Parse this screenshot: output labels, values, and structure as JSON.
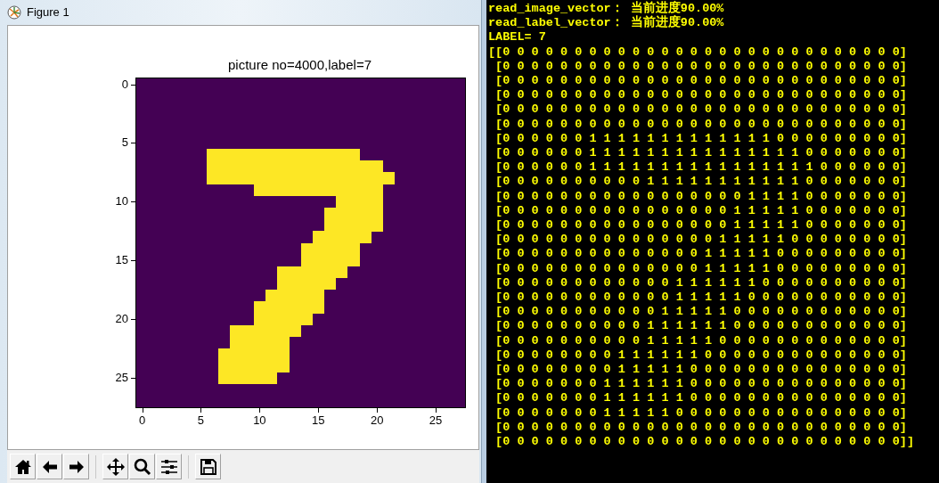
{
  "figure_window": {
    "title": "Figure 1",
    "plot": {
      "title": "picture no=4000,label=7",
      "xticks": [
        "0",
        "5",
        "10",
        "15",
        "20",
        "25"
      ],
      "yticks": [
        "0",
        "5",
        "10",
        "15",
        "20",
        "25"
      ]
    },
    "toolbar": [
      {
        "kind": "home"
      },
      {
        "kind": "back"
      },
      {
        "kind": "forward"
      },
      {
        "kind": "separator"
      },
      {
        "kind": "pan"
      },
      {
        "kind": "zoom"
      },
      {
        "kind": "subplots"
      },
      {
        "kind": "separator"
      },
      {
        "kind": "save"
      }
    ]
  },
  "console": {
    "log": [
      "read_image_vector： 当前进度90.00%",
      "read_label_vector： 当前进度90.00%",
      "LABEL= 7"
    ],
    "matrix": [
      "[[0 0 0 0 0 0 0 0 0 0 0 0 0 0 0 0 0 0 0 0 0 0 0 0 0 0 0 0]",
      " [0 0 0 0 0 0 0 0 0 0 0 0 0 0 0 0 0 0 0 0 0 0 0 0 0 0 0 0]",
      " [0 0 0 0 0 0 0 0 0 0 0 0 0 0 0 0 0 0 0 0 0 0 0 0 0 0 0 0]",
      " [0 0 0 0 0 0 0 0 0 0 0 0 0 0 0 0 0 0 0 0 0 0 0 0 0 0 0 0]",
      " [0 0 0 0 0 0 0 0 0 0 0 0 0 0 0 0 0 0 0 0 0 0 0 0 0 0 0 0]",
      " [0 0 0 0 0 0 0 0 0 0 0 0 0 0 0 0 0 0 0 0 0 0 0 0 0 0 0 0]",
      " [0 0 0 0 0 0 1 1 1 1 1 1 1 1 1 1 1 1 1 0 0 0 0 0 0 0 0 0]",
      " [0 0 0 0 0 0 1 1 1 1 1 1 1 1 1 1 1 1 1 1 1 0 0 0 0 0 0 0]",
      " [0 0 0 0 0 0 1 1 1 1 1 1 1 1 1 1 1 1 1 1 1 1 0 0 0 0 0 0]",
      " [0 0 0 0 0 0 0 0 0 0 1 1 1 1 1 1 1 1 1 1 1 0 0 0 0 0 0 0]",
      " [0 0 0 0 0 0 0 0 0 0 0 0 0 0 0 0 0 1 1 1 1 0 0 0 0 0 0 0]",
      " [0 0 0 0 0 0 0 0 0 0 0 0 0 0 0 0 1 1 1 1 1 0 0 0 0 0 0 0]",
      " [0 0 0 0 0 0 0 0 0 0 0 0 0 0 0 0 1 1 1 1 1 0 0 0 0 0 0 0]",
      " [0 0 0 0 0 0 0 0 0 0 0 0 0 0 0 1 1 1 1 1 0 0 0 0 0 0 0 0]",
      " [0 0 0 0 0 0 0 0 0 0 0 0 0 0 1 1 1 1 1 0 0 0 0 0 0 0 0 0]",
      " [0 0 0 0 0 0 0 0 0 0 0 0 0 0 1 1 1 1 1 0 0 0 0 0 0 0 0 0]",
      " [0 0 0 0 0 0 0 0 0 0 0 0 1 1 1 1 1 1 0 0 0 0 0 0 0 0 0 0]",
      " [0 0 0 0 0 0 0 0 0 0 0 0 1 1 1 1 1 0 0 0 0 0 0 0 0 0 0 0]",
      " [0 0 0 0 0 0 0 0 0 0 0 1 1 1 1 1 0 0 0 0 0 0 0 0 0 0 0 0]",
      " [0 0 0 0 0 0 0 0 0 0 1 1 1 1 1 1 0 0 0 0 0 0 0 0 0 0 0 0]",
      " [0 0 0 0 0 0 0 0 0 0 1 1 1 1 1 0 0 0 0 0 0 0 0 0 0 0 0 0]",
      " [0 0 0 0 0 0 0 0 1 1 1 1 1 1 0 0 0 0 0 0 0 0 0 0 0 0 0 0]",
      " [0 0 0 0 0 0 0 0 1 1 1 1 1 0 0 0 0 0 0 0 0 0 0 0 0 0 0 0]",
      " [0 0 0 0 0 0 0 1 1 1 1 1 1 0 0 0 0 0 0 0 0 0 0 0 0 0 0 0]",
      " [0 0 0 0 0 0 0 1 1 1 1 1 1 0 0 0 0 0 0 0 0 0 0 0 0 0 0 0]",
      " [0 0 0 0 0 0 0 1 1 1 1 1 0 0 0 0 0 0 0 0 0 0 0 0 0 0 0 0]",
      " [0 0 0 0 0 0 0 0 0 0 0 0 0 0 0 0 0 0 0 0 0 0 0 0 0 0 0 0]",
      " [0 0 0 0 0 0 0 0 0 0 0 0 0 0 0 0 0 0 0 0 0 0 0 0 0 0 0 0]]"
    ]
  }
}
